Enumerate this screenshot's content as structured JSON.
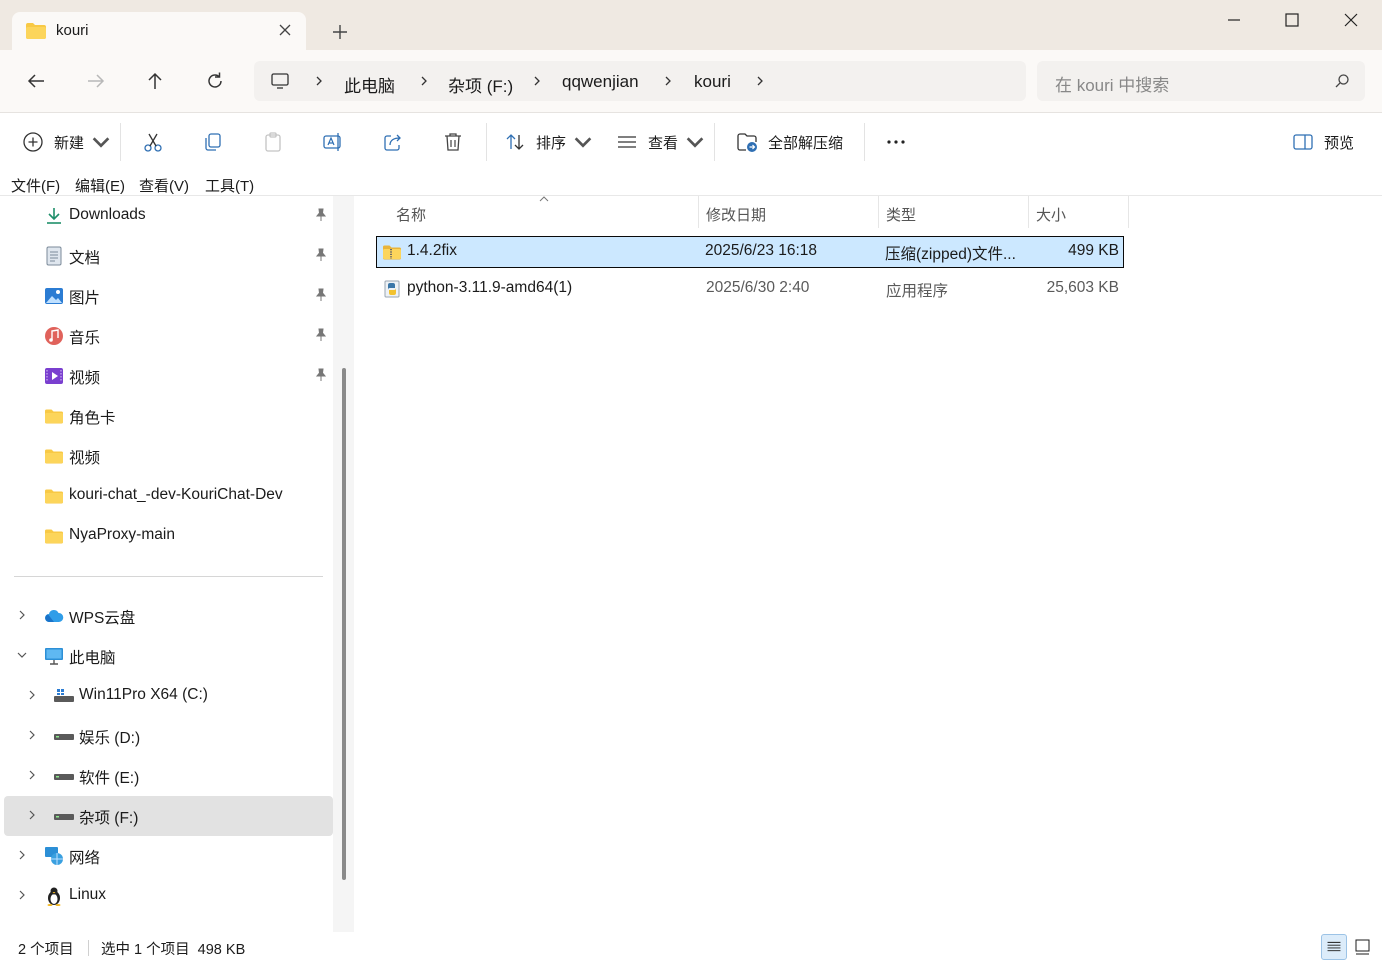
{
  "window": {
    "tab_title": "kouri",
    "minimize_label": "最小化",
    "maximize_label": "最大化",
    "close_label": "关闭"
  },
  "address": {
    "breadcrumbs": [
      "此电脑",
      "杂项 (F:)",
      "qqwenjian",
      "kouri"
    ],
    "search_placeholder": "在 kouri 中搜索"
  },
  "toolbar": {
    "new_label": "新建",
    "sort_label": "排序",
    "view_label": "查看",
    "extract_label": "全部解压缩",
    "preview_label": "预览"
  },
  "menubar": [
    "文件(F)",
    "编辑(E)",
    "查看(V)",
    "工具(T)"
  ],
  "sidebar": {
    "quick": [
      {
        "label": "Downloads",
        "icon": "download-icon",
        "pinned": true
      },
      {
        "label": "文档",
        "icon": "document-icon",
        "pinned": true
      },
      {
        "label": "图片",
        "icon": "pictures-icon",
        "pinned": true
      },
      {
        "label": "音乐",
        "icon": "music-icon",
        "pinned": true
      },
      {
        "label": "视频",
        "icon": "videos-icon",
        "pinned": true
      },
      {
        "label": "角色卡",
        "icon": "folder-icon",
        "pinned": false
      },
      {
        "label": "视频",
        "icon": "folder-icon",
        "pinned": false
      },
      {
        "label": "kouri-chat_-dev-KouriChat-Dev",
        "icon": "folder-icon",
        "pinned": false
      },
      {
        "label": "NyaProxy-main",
        "icon": "folder-icon",
        "pinned": false
      }
    ],
    "tree": [
      {
        "label": "WPS云盘",
        "icon": "cloud-icon"
      },
      {
        "label": "此电脑",
        "icon": "computer-icon"
      },
      {
        "label": "Win11Pro X64 (C:)",
        "icon": "system-drive-icon"
      },
      {
        "label": "娱乐 (D:)",
        "icon": "drive-icon"
      },
      {
        "label": "软件 (E:)",
        "icon": "drive-icon"
      },
      {
        "label": "杂项 (F:)",
        "icon": "drive-icon"
      },
      {
        "label": "网络",
        "icon": "network-icon"
      },
      {
        "label": "Linux",
        "icon": "linux-icon"
      }
    ]
  },
  "columns": [
    "名称",
    "修改日期",
    "类型",
    "大小"
  ],
  "files": [
    {
      "name": "1.4.2fix",
      "date": "2025/6/23 16:18",
      "type": "压缩(zipped)文件...",
      "size": "499 KB",
      "icon": "zip-folder-icon"
    },
    {
      "name": "python-3.11.9-amd64(1)",
      "date": "2025/6/30 2:40",
      "type": "应用程序",
      "size": "25,603 KB",
      "icon": "python-installer-icon"
    }
  ],
  "status": {
    "count": "2 个项目",
    "selection": "选中 1 个项目  498 KB"
  },
  "colors": {
    "selection": "#cce8ff",
    "title_bar": "#efe9e2",
    "folder": "#f8c945"
  }
}
